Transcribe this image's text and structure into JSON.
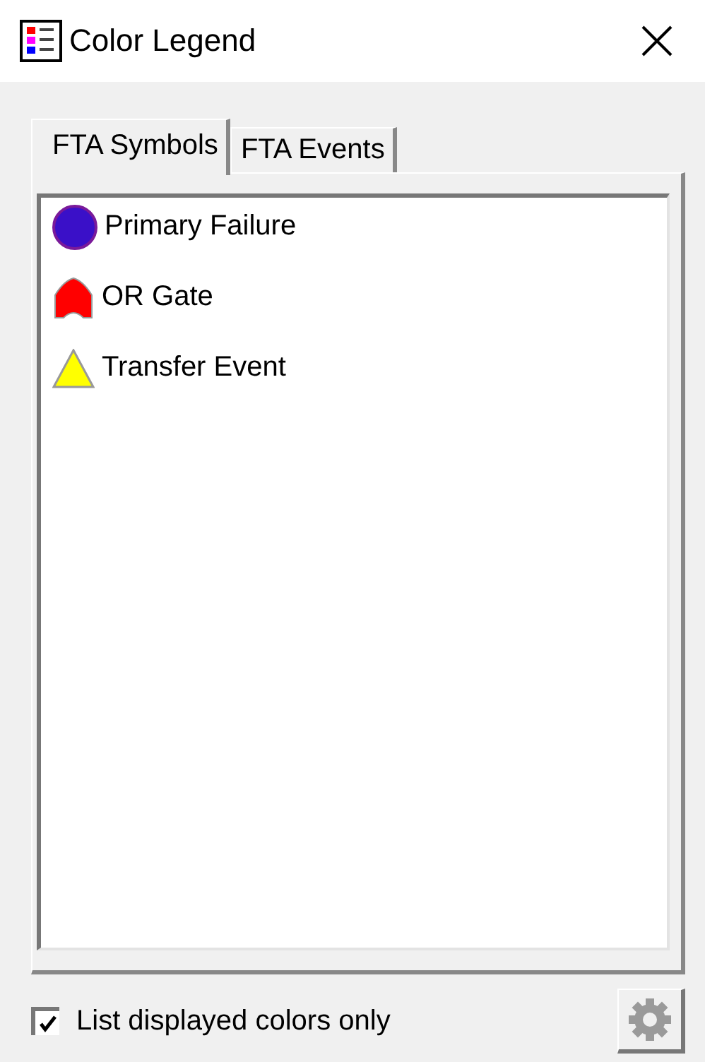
{
  "window": {
    "title": "Color Legend"
  },
  "tabs": [
    {
      "label": "FTA Symbols",
      "selected": true
    },
    {
      "label": "FTA Events",
      "selected": false
    }
  ],
  "legend_items": [
    {
      "label": "Primary Failure",
      "kind": "circle",
      "color": "#3a10c8"
    },
    {
      "label": "OR Gate",
      "kind": "gate",
      "color": "#ff0000"
    },
    {
      "label": "Transfer Event",
      "kind": "triangle",
      "color": "#ffff00"
    }
  ],
  "filter_checkbox": {
    "label": "List displayed colors only",
    "checked": true
  },
  "settings_button": {
    "disabled": true
  }
}
